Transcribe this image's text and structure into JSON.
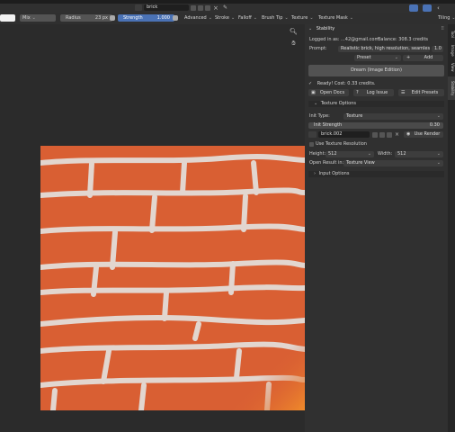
{
  "toolbar": {
    "mix": "Mix",
    "radius_label": "Radius",
    "radius_value": "23 px",
    "strength_label": "Strength",
    "strength_value": "1.000",
    "menus": [
      "Advanced",
      "Stroke",
      "Falloff",
      "Brush Tip",
      "Texture",
      "Texture Mask"
    ],
    "tiling": "Tiling"
  },
  "header": {
    "image_name": "brick"
  },
  "stability": {
    "title": "Stability",
    "logged_in": "Logged in as: ...42@gmail.com",
    "balance": "Balance: 308.3 credits",
    "prompt_label": "Prompt:",
    "prompt_value": "Realistic brick, high resolution, seamles...",
    "prompt_weight": "1.0",
    "preset": "Preset",
    "add": "Add",
    "dream_button": "Dream (Image Edition)",
    "status": "Ready! Cost: 0.33 credits.",
    "open_docs": "Open Docs",
    "log_issue": "Log Issue",
    "edit_presets": "Edit Presets"
  },
  "texture_options": {
    "title": "Texture Options",
    "init_type_label": "Init Type:",
    "init_type_value": "Texture",
    "init_strength_label": "Init Strength",
    "init_strength_value": "0.30",
    "texture_name": "brick.002",
    "use_render": "Use Render",
    "use_texture_resolution": "Use Texture Resolution",
    "height_label": "Height:",
    "height_value": "512",
    "width_label": "Width:",
    "width_value": "512",
    "open_result_label": "Open Result in:",
    "open_result_value": "Texture View"
  },
  "input_options": {
    "title": "Input Options"
  },
  "side_tabs": [
    "Tool",
    "Image",
    "View",
    "Stability"
  ],
  "colors": {
    "accent": "#4a72b5",
    "brick": "#d95f33",
    "mortar": "#e2d6cf",
    "panel": "#303030"
  }
}
